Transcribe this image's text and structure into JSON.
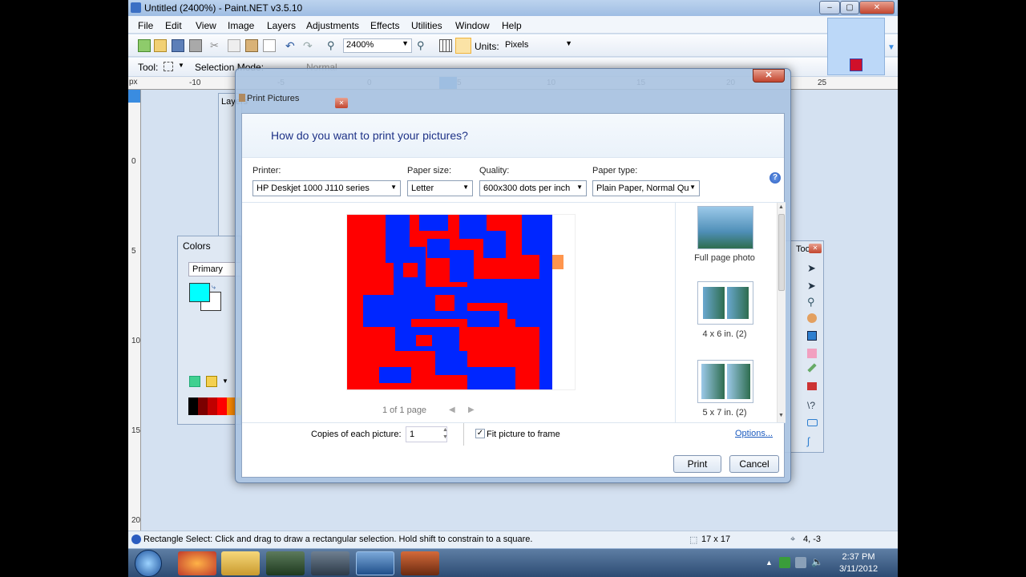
{
  "window": {
    "title": "Untitled (2400%) - Paint.NET v3.5.10",
    "min": "–",
    "max": "▢",
    "close": "✕"
  },
  "menu": [
    "File",
    "Edit",
    "View",
    "Image",
    "Layers",
    "Adjustments",
    "Effects",
    "Utilities",
    "Window",
    "Help"
  ],
  "toolbar": {
    "zoom": "2400%",
    "units_label": "Units:",
    "units_value": "Pixels",
    "tool_label": "Tool:",
    "selection_mode_label": "Selection Mode:",
    "selection_mode_value": "Normal"
  },
  "ruler": {
    "unit": "px",
    "h_ticks": [
      "-10",
      "-5",
      "0",
      "5",
      "10",
      "15",
      "20",
      "25"
    ],
    "v_ticks": [
      "0",
      "5",
      "10",
      "15",
      "20"
    ]
  },
  "floaters": {
    "layers_title": "Layers",
    "colors_title": "Colors",
    "colors_mode": "Primary",
    "tools_title": "Tools",
    "primary_color": "#00ffff",
    "secondary_color": "#ffffff"
  },
  "dialog": {
    "title": "Print Pictures",
    "close": "✕",
    "heading": "How do you want to print your pictures?",
    "printer_label": "Printer:",
    "printer_value": "HP Deskjet 1000 J110 series",
    "paper_size_label": "Paper size:",
    "paper_size_value": "Letter",
    "quality_label": "Quality:",
    "quality_value": "600x300 dots per inch",
    "paper_type_label": "Paper type:",
    "paper_type_value": "Plain Paper, Normal Qu",
    "help": "?",
    "page_indicator": "1 of 1 page",
    "layouts": [
      {
        "label": "Full page photo"
      },
      {
        "label": "4 x 6 in. (2)"
      },
      {
        "label": "5 x 7 in. (2)"
      }
    ],
    "copies_label": "Copies of each picture:",
    "copies_value": "1",
    "fit_label": "Fit picture to frame",
    "fit_checked": true,
    "options_link": "Options...",
    "print_button": "Print",
    "cancel_button": "Cancel"
  },
  "status": {
    "hint": "Rectangle Select: Click and drag to draw a rectangular selection. Hold shift to constrain to a square.",
    "size": "17 x 17",
    "position": "4, -3"
  },
  "taskbar": {
    "time": "2:37 PM",
    "date": "3/11/2012"
  },
  "colors": {
    "image_red": "#ff0000",
    "image_blue": "#0026ff",
    "accent": "#1e3287"
  }
}
